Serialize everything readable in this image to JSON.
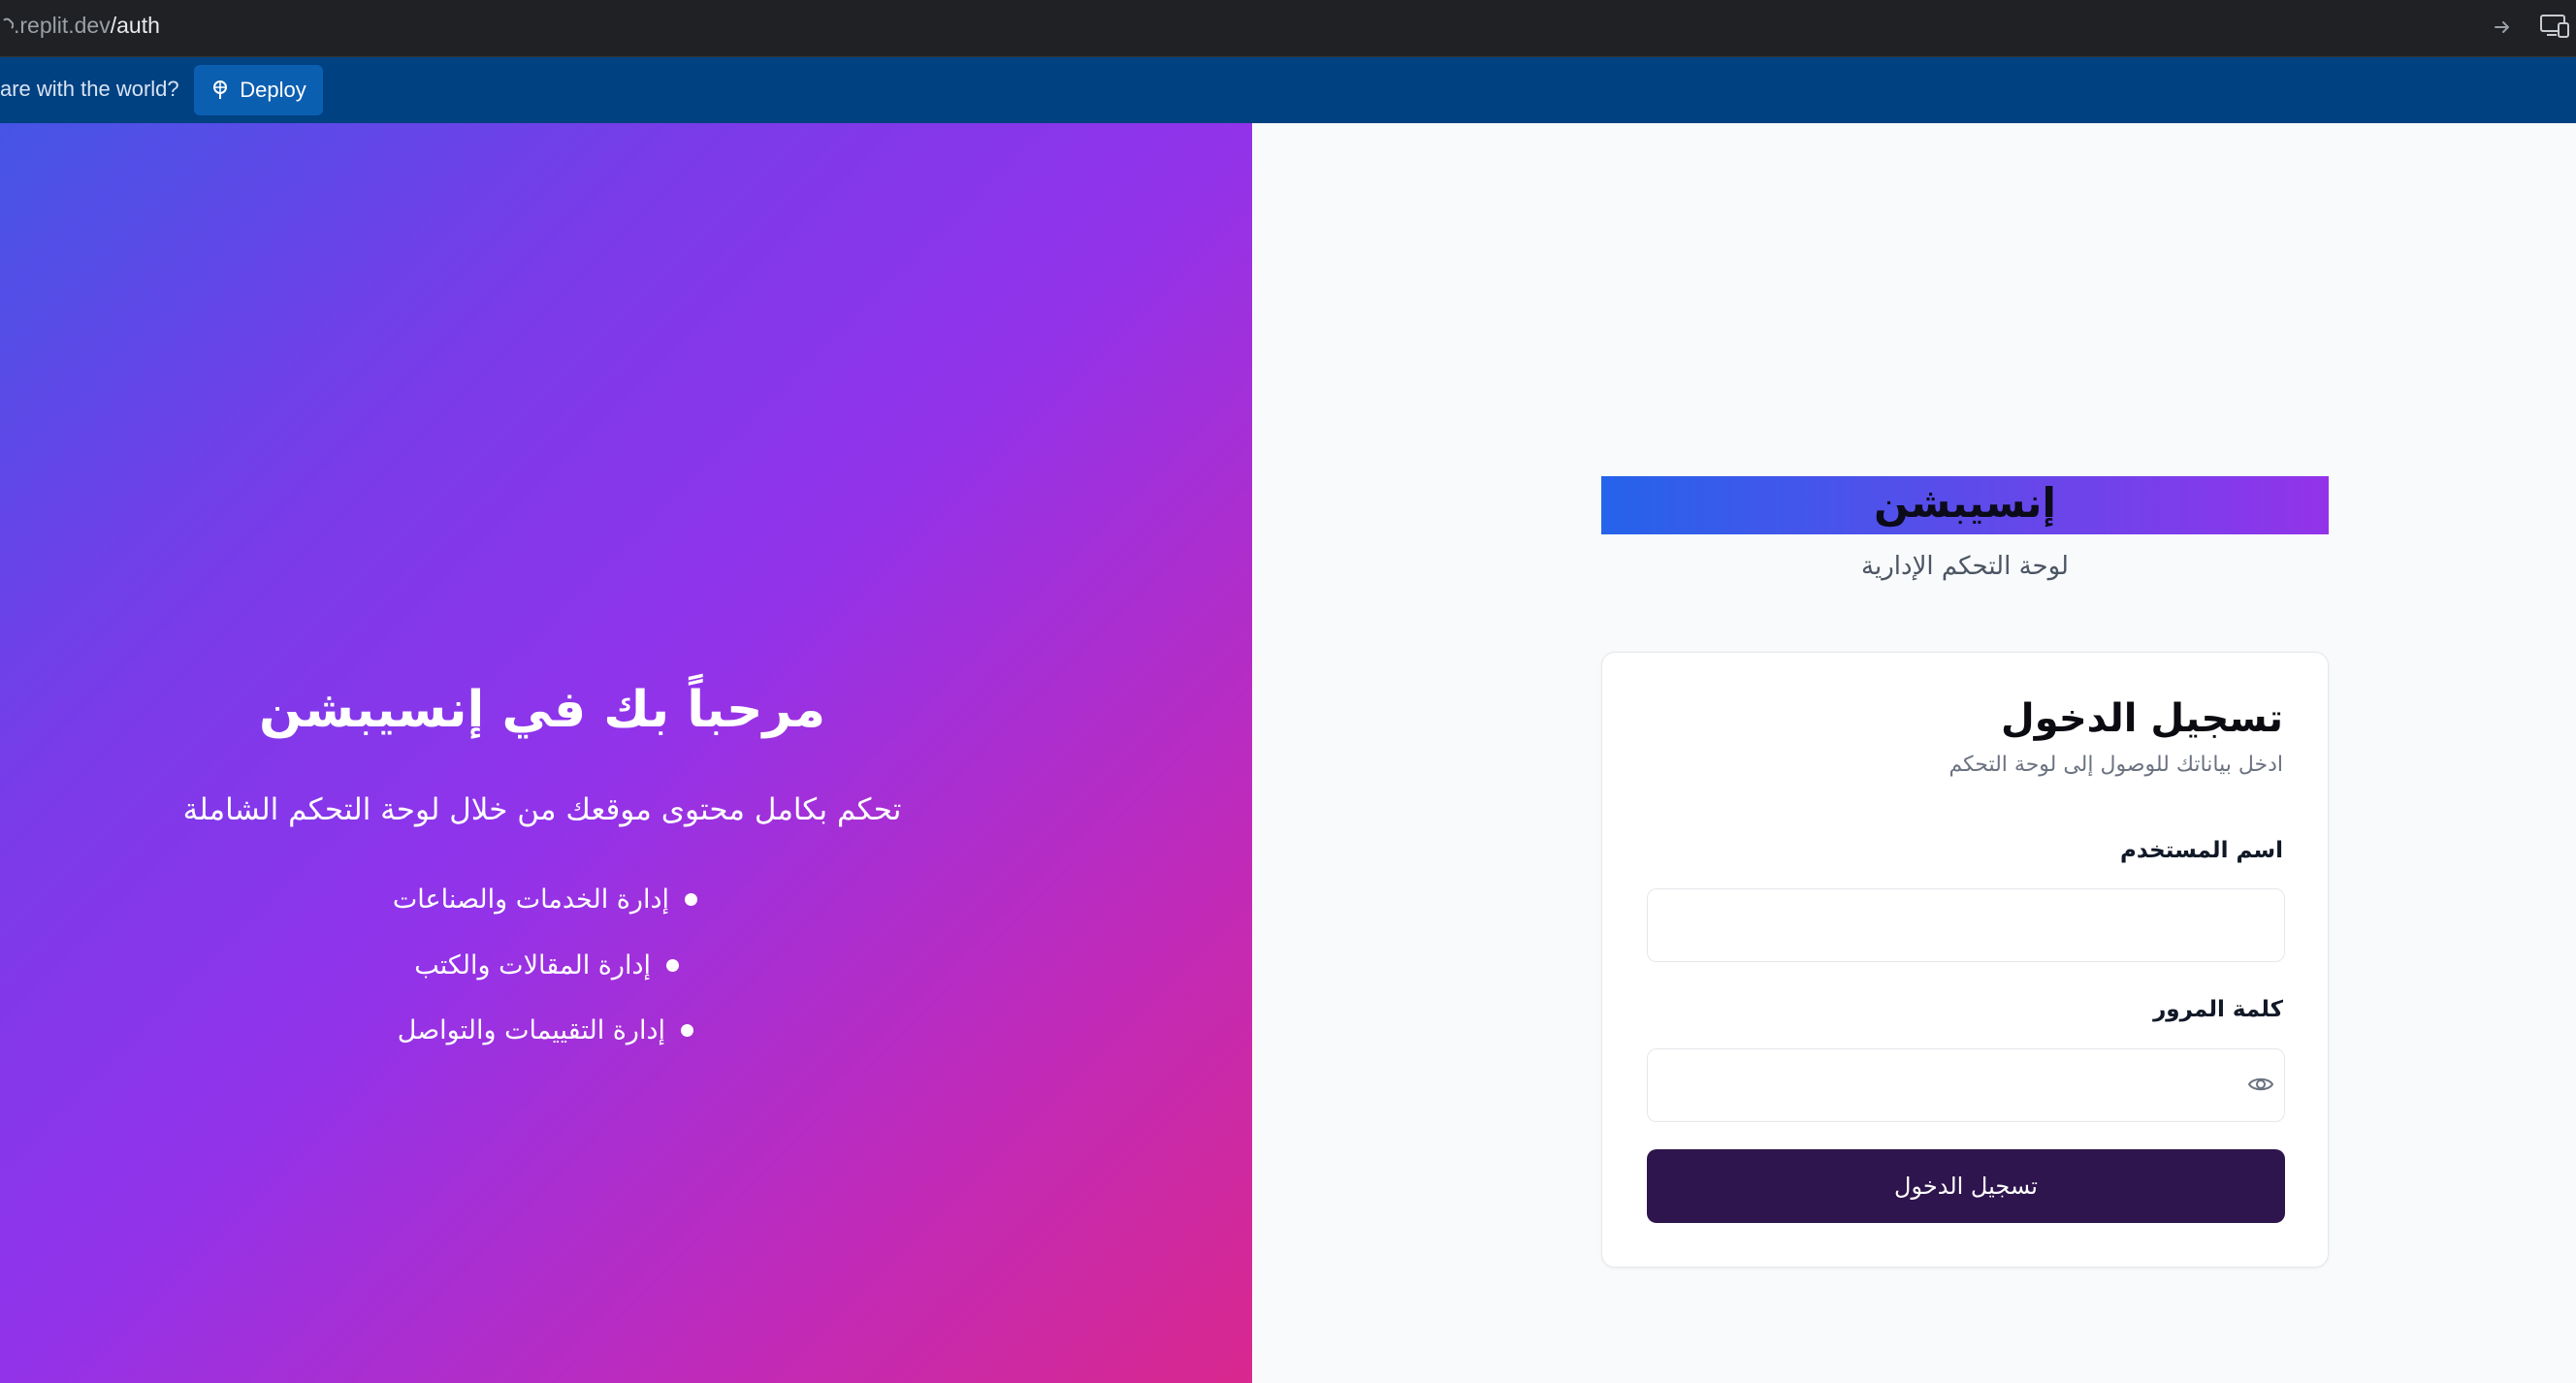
{
  "browser": {
    "url_host": ".replit.dev",
    "url_path": "/auth"
  },
  "deploy_bar": {
    "share_text": "are with the world?",
    "deploy_label": "Deploy"
  },
  "hero": {
    "title": "مرحباً بك في إنسيبشن",
    "subtitle": "تحكم بكامل محتوى موقعك من خلال لوحة التحكم الشاملة",
    "features": [
      "إدارة الخدمات والصناعات",
      "إدارة المقالات والكتب",
      "إدارة التقييمات والتواصل"
    ]
  },
  "brand": {
    "name": "إنسيبشن",
    "subtitle": "لوحة التحكم الإدارية"
  },
  "login": {
    "title": "تسجيل الدخول",
    "description": "ادخل بياناتك للوصول إلى لوحة التحكم",
    "username_label": "اسم المستخدم",
    "username_value": "",
    "password_label": "كلمة المرور",
    "password_value": "",
    "submit_label": "تسجيل الدخول"
  },
  "colors": {
    "brand_gradient_start": "#2563eb",
    "brand_gradient_end": "#9333ea",
    "submit_bg": "#2e154d",
    "deploy_bar_bg": "#004182"
  }
}
